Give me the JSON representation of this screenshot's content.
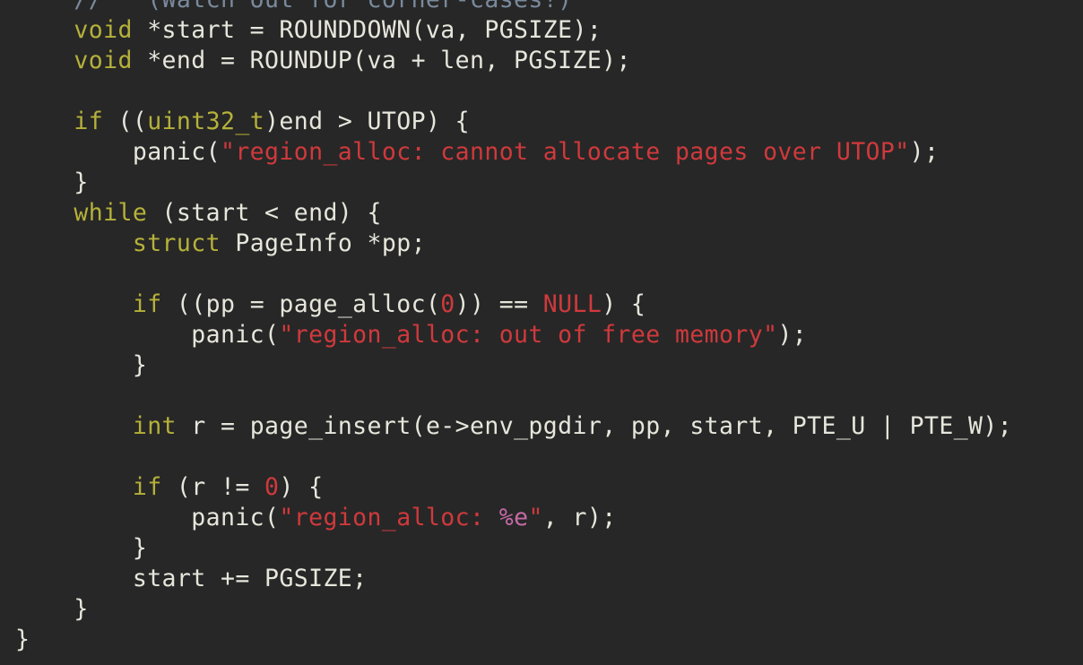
{
  "editor": {
    "background": "#272727",
    "colors": {
      "plain": "#e6e6dc",
      "keyword": "#b5b13a",
      "string": "#d0393c",
      "comment": "#7a8a9c",
      "format": "#c56aa6"
    },
    "lines": [
      {
        "tokens": [
          {
            "t": "    "
          },
          {
            "t": "//   (Watch out for corner-cases!)",
            "k": "comment"
          }
        ]
      },
      {
        "tokens": [
          {
            "t": "    "
          },
          {
            "t": "void",
            "k": "type"
          },
          {
            "t": " *start = ROUNDDOWN(va, PGSIZE);"
          }
        ]
      },
      {
        "tokens": [
          {
            "t": "    "
          },
          {
            "t": "void",
            "k": "type"
          },
          {
            "t": " *end = ROUNDUP(va + len, PGSIZE);"
          }
        ]
      },
      {
        "tokens": []
      },
      {
        "tokens": [
          {
            "t": "    "
          },
          {
            "t": "if",
            "k": "keyword"
          },
          {
            "t": " (("
          },
          {
            "t": "uint32_t",
            "k": "type"
          },
          {
            "t": ")end > UTOP) {"
          }
        ]
      },
      {
        "tokens": [
          {
            "t": "        panic("
          },
          {
            "t": "\"region_alloc: cannot allocate pages over UTOP\"",
            "k": "string"
          },
          {
            "t": ");"
          }
        ]
      },
      {
        "tokens": [
          {
            "t": "    }"
          }
        ]
      },
      {
        "tokens": [
          {
            "t": "    "
          },
          {
            "t": "while",
            "k": "keyword"
          },
          {
            "t": " (start < end) {"
          }
        ]
      },
      {
        "tokens": [
          {
            "t": "        "
          },
          {
            "t": "struct",
            "k": "keyword"
          },
          {
            "t": " PageInfo *pp;"
          }
        ]
      },
      {
        "tokens": []
      },
      {
        "tokens": [
          {
            "t": "        "
          },
          {
            "t": "if",
            "k": "keyword"
          },
          {
            "t": " ((pp = page_alloc("
          },
          {
            "t": "0",
            "k": "number"
          },
          {
            "t": ")) == "
          },
          {
            "t": "NULL",
            "k": "const"
          },
          {
            "t": ") {"
          }
        ]
      },
      {
        "tokens": [
          {
            "t": "            panic("
          },
          {
            "t": "\"region_alloc: out of free memory\"",
            "k": "string"
          },
          {
            "t": ");"
          }
        ]
      },
      {
        "tokens": [
          {
            "t": "        }"
          }
        ]
      },
      {
        "tokens": []
      },
      {
        "tokens": [
          {
            "t": "        "
          },
          {
            "t": "int",
            "k": "type"
          },
          {
            "t": " r = page_insert(e->env_pgdir, pp, start, PTE_U | PTE_W);"
          }
        ]
      },
      {
        "tokens": []
      },
      {
        "tokens": [
          {
            "t": "        "
          },
          {
            "t": "if",
            "k": "keyword"
          },
          {
            "t": " (r != "
          },
          {
            "t": "0",
            "k": "number"
          },
          {
            "t": ") {"
          }
        ]
      },
      {
        "tokens": [
          {
            "t": "            panic("
          },
          {
            "t": "\"region_alloc: ",
            "k": "string"
          },
          {
            "t": "%e",
            "k": "format"
          },
          {
            "t": "\"",
            "k": "string"
          },
          {
            "t": ", r);"
          }
        ]
      },
      {
        "tokens": [
          {
            "t": "        }"
          }
        ]
      },
      {
        "tokens": [
          {
            "t": "        start += PGSIZE;"
          }
        ]
      },
      {
        "tokens": [
          {
            "t": "    }"
          }
        ]
      },
      {
        "tokens": [
          {
            "t": "}"
          }
        ]
      }
    ]
  }
}
